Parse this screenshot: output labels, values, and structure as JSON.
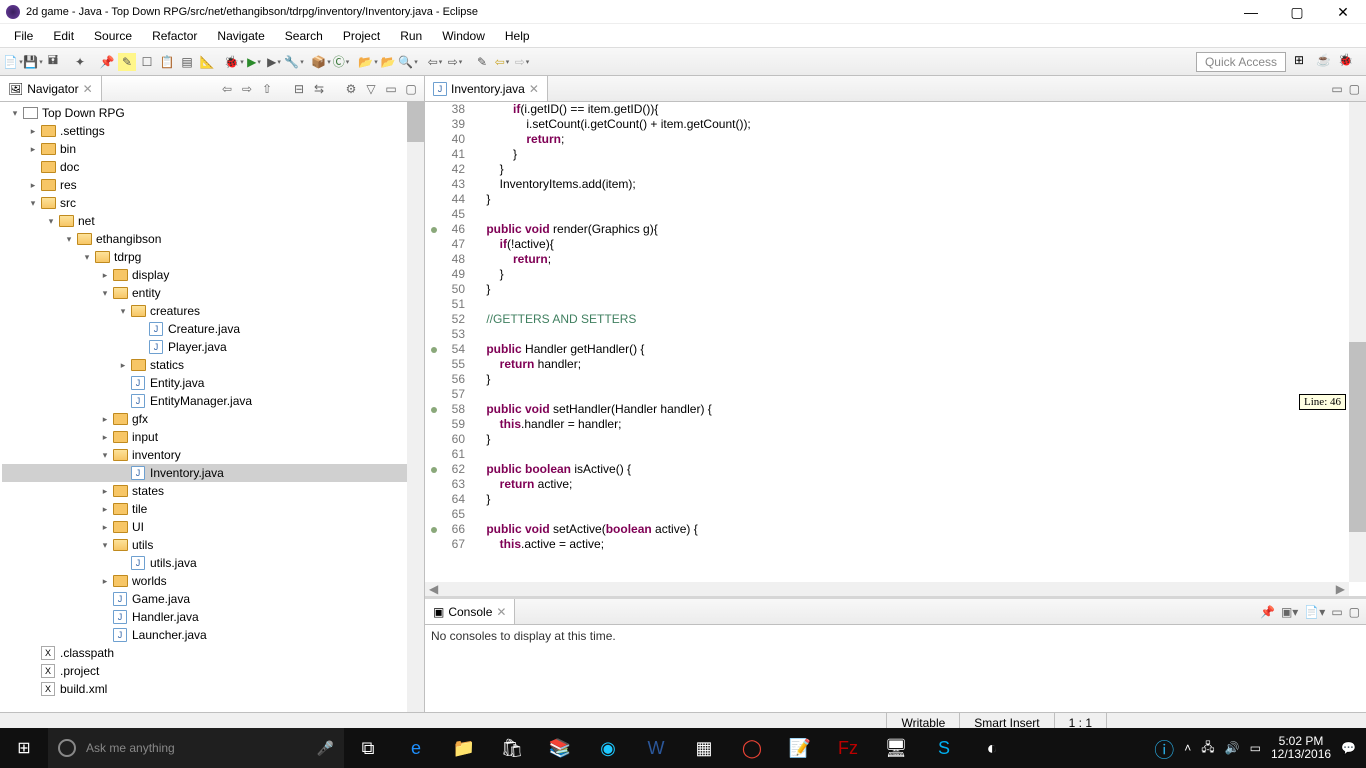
{
  "window": {
    "title": "2d game - Java - Top Down RPG/src/net/ethangibson/tdrpg/inventory/Inventory.java - Eclipse"
  },
  "menu": [
    "File",
    "Edit",
    "Source",
    "Refactor",
    "Navigate",
    "Search",
    "Project",
    "Run",
    "Window",
    "Help"
  ],
  "quick_access": "Quick Access",
  "navigator": {
    "title": "Navigator"
  },
  "tree": {
    "project": "Top Down RPG",
    "nodes": [
      {
        "d": 1,
        "t": ">",
        "k": "f",
        "l": ".settings"
      },
      {
        "d": 1,
        "t": ">",
        "k": "f",
        "l": "bin"
      },
      {
        "d": 1,
        "t": "",
        "k": "f",
        "l": "doc"
      },
      {
        "d": 1,
        "t": ">",
        "k": "f",
        "l": "res"
      },
      {
        "d": 1,
        "t": "v",
        "k": "fo",
        "l": "src"
      },
      {
        "d": 2,
        "t": "v",
        "k": "fo",
        "l": "net"
      },
      {
        "d": 3,
        "t": "v",
        "k": "fo",
        "l": "ethangibson"
      },
      {
        "d": 4,
        "t": "v",
        "k": "fo",
        "l": "tdrpg"
      },
      {
        "d": 5,
        "t": ">",
        "k": "f",
        "l": "display"
      },
      {
        "d": 5,
        "t": "v",
        "k": "fo",
        "l": "entity"
      },
      {
        "d": 6,
        "t": "v",
        "k": "fo",
        "l": "creatures"
      },
      {
        "d": 7,
        "t": "",
        "k": "j",
        "l": "Creature.java"
      },
      {
        "d": 7,
        "t": "",
        "k": "j",
        "l": "Player.java"
      },
      {
        "d": 6,
        "t": ">",
        "k": "f",
        "l": "statics"
      },
      {
        "d": 6,
        "t": "",
        "k": "j",
        "l": "Entity.java"
      },
      {
        "d": 6,
        "t": "",
        "k": "j",
        "l": "EntityManager.java"
      },
      {
        "d": 5,
        "t": ">",
        "k": "f",
        "l": "gfx"
      },
      {
        "d": 5,
        "t": ">",
        "k": "f",
        "l": "input"
      },
      {
        "d": 5,
        "t": "v",
        "k": "fo",
        "l": "inventory"
      },
      {
        "d": 6,
        "t": "",
        "k": "j",
        "l": "Inventory.java",
        "sel": true
      },
      {
        "d": 5,
        "t": ">",
        "k": "f",
        "l": "states"
      },
      {
        "d": 5,
        "t": ">",
        "k": "f",
        "l": "tile"
      },
      {
        "d": 5,
        "t": ">",
        "k": "f",
        "l": "UI"
      },
      {
        "d": 5,
        "t": "v",
        "k": "fo",
        "l": "utils"
      },
      {
        "d": 6,
        "t": "",
        "k": "j",
        "l": "utils.java"
      },
      {
        "d": 5,
        "t": ">",
        "k": "f",
        "l": "worlds"
      },
      {
        "d": 5,
        "t": "",
        "k": "j",
        "l": "Game.java"
      },
      {
        "d": 5,
        "t": "",
        "k": "j",
        "l": "Handler.java"
      },
      {
        "d": 5,
        "t": "",
        "k": "j",
        "l": "Launcher.java"
      },
      {
        "d": 1,
        "t": "",
        "k": "x",
        "l": ".classpath"
      },
      {
        "d": 1,
        "t": "",
        "k": "x",
        "l": ".project"
      },
      {
        "d": 1,
        "t": "",
        "k": "x",
        "l": "build.xml"
      }
    ]
  },
  "editor": {
    "tab": "Inventory.java",
    "line_tooltip": "Line: 46",
    "lines": [
      {
        "n": 38,
        "h": "            <kw>if</kw>(i.getID() == item.getID()){"
      },
      {
        "n": 39,
        "h": "                i.setCount(i.getCount() + item.getCount());"
      },
      {
        "n": 40,
        "h": "                <kw>return</kw>;"
      },
      {
        "n": 41,
        "h": "            }"
      },
      {
        "n": 42,
        "h": "        }"
      },
      {
        "n": 43,
        "h": "        InventoryItems.add(item);"
      },
      {
        "n": 44,
        "h": "    }"
      },
      {
        "n": 45,
        "h": ""
      },
      {
        "n": 46,
        "m": 1,
        "h": "    <kw>public void</kw> render(Graphics g){"
      },
      {
        "n": 47,
        "h": "        <kw>if</kw>(!active){"
      },
      {
        "n": 48,
        "h": "            <kw>return</kw>;"
      },
      {
        "n": 49,
        "h": "        }"
      },
      {
        "n": 50,
        "h": "    }"
      },
      {
        "n": 51,
        "h": ""
      },
      {
        "n": 52,
        "h": "    <com>//GETTERS AND SETTERS</com>"
      },
      {
        "n": 53,
        "h": ""
      },
      {
        "n": 54,
        "m": 1,
        "h": "    <kw>public</kw> Handler getHandler() {"
      },
      {
        "n": 55,
        "h": "        <kw>return</kw> handler;"
      },
      {
        "n": 56,
        "h": "    }"
      },
      {
        "n": 57,
        "h": ""
      },
      {
        "n": 58,
        "m": 1,
        "h": "    <kw>public void</kw> setHandler(Handler handler) {"
      },
      {
        "n": 59,
        "h": "        <kw>this</kw>.handler = handler;"
      },
      {
        "n": 60,
        "h": "    }"
      },
      {
        "n": 61,
        "h": ""
      },
      {
        "n": 62,
        "m": 1,
        "h": "    <kw>public boolean</kw> isActive() {"
      },
      {
        "n": 63,
        "h": "        <kw>return</kw> active;"
      },
      {
        "n": 64,
        "h": "    }"
      },
      {
        "n": 65,
        "h": ""
      },
      {
        "n": 66,
        "m": 1,
        "h": "    <kw>public void</kw> setActive(<kw>boolean</kw> active) {"
      },
      {
        "n": 67,
        "h": "        <kw>this</kw>.active = active;"
      }
    ]
  },
  "console": {
    "title": "Console",
    "message": "No consoles to display at this time."
  },
  "status": {
    "writable": "Writable",
    "insert": "Smart Insert",
    "pos": "1 : 1"
  },
  "taskbar": {
    "search_placeholder": "Ask me anything",
    "time": "5:02 PM",
    "date": "12/13/2016"
  }
}
